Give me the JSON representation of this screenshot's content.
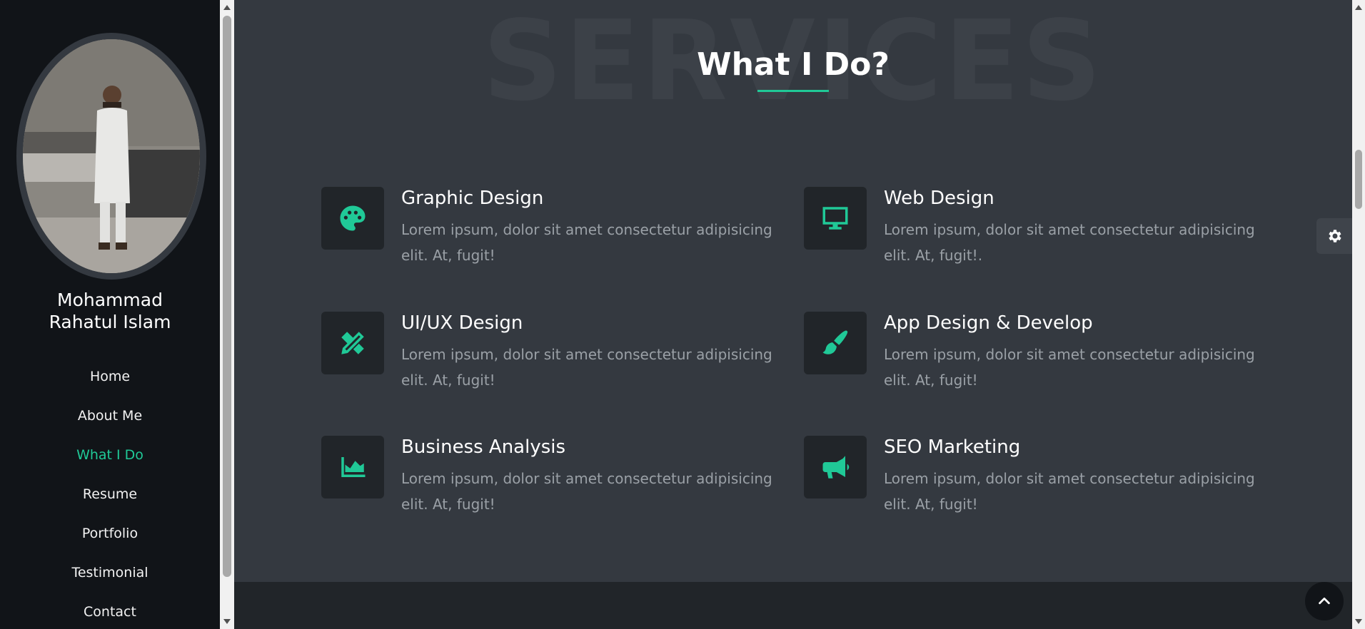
{
  "profile": {
    "name_line1": "Mohammad",
    "name_line2": "Rahatul Islam"
  },
  "nav": {
    "items": [
      {
        "label": "Home",
        "active": false
      },
      {
        "label": "About Me",
        "active": false
      },
      {
        "label": "What I Do",
        "active": true
      },
      {
        "label": "Resume",
        "active": false
      },
      {
        "label": "Portfolio",
        "active": false
      },
      {
        "label": "Testimonial",
        "active": false
      },
      {
        "label": "Contact",
        "active": false
      }
    ]
  },
  "section": {
    "background_word": "SERVICES",
    "title": "What I Do?"
  },
  "services": [
    {
      "title": "Graphic Design",
      "text": "Lorem ipsum, dolor sit amet consectetur adipisicing elit. At, fugit!",
      "icon": "palette-icon"
    },
    {
      "title": "Web Design",
      "text": "Lorem ipsum, dolor sit amet consectetur adipisicing elit. At, fugit!.",
      "icon": "desktop-icon"
    },
    {
      "title": "UI/UX Design",
      "text": "Lorem ipsum, dolor sit amet consectetur adipisicing elit. At, fugit!",
      "icon": "pencil-ruler-icon"
    },
    {
      "title": "App Design & Develop",
      "text": "Lorem ipsum, dolor sit amet consectetur adipisicing elit. At, fugit!",
      "icon": "paint-brush-icon"
    },
    {
      "title": "Business Analysis",
      "text": "Lorem ipsum, dolor sit amet consectetur adipisicing elit. At, fugit!",
      "icon": "area-chart-icon"
    },
    {
      "title": "SEO Marketing",
      "text": "Lorem ipsum, dolor sit amet consectetur adipisicing elit. At, fugit!",
      "icon": "bullhorn-icon"
    }
  ],
  "colors": {
    "accent": "#20c997",
    "sidebar_bg": "#111418",
    "main_bg": "#343940",
    "card_bg": "#212529",
    "muted_text": "#9aa0a6"
  }
}
